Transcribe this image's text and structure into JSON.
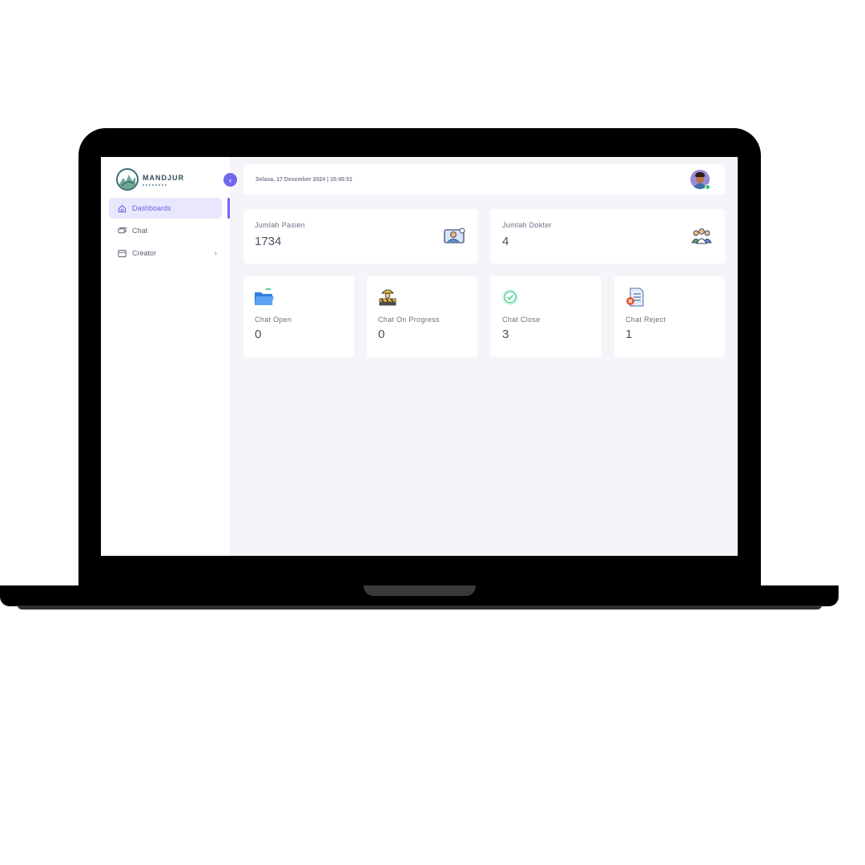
{
  "app": {
    "logo_name": "MANDJUR"
  },
  "sidebar": {
    "collapse_icon": "chevron-left-icon",
    "items": [
      {
        "label": "Dashboards",
        "icon": "home-icon",
        "active": true
      },
      {
        "label": "Chat",
        "icon": "chat-icon",
        "active": false
      },
      {
        "label": "Creator",
        "icon": "window-icon",
        "active": false,
        "has_submenu": true
      }
    ]
  },
  "header": {
    "datetime": "Selasa, 17 Desember 2024 | 10:45:51"
  },
  "stats": [
    {
      "label": "Jumlah Pasien",
      "value": "1734",
      "icon": "patient-icon"
    },
    {
      "label": "Jumlah Dokter",
      "value": "4",
      "icon": "doctors-icon"
    }
  ],
  "chat_stats": [
    {
      "label": "Chat Open",
      "value": "0",
      "icon": "open-folder-icon"
    },
    {
      "label": "Chat On Progress",
      "value": "0",
      "icon": "under-construction-icon"
    },
    {
      "label": "Chat Close",
      "value": "3",
      "icon": "check-circle-icon"
    },
    {
      "label": "Chat Reject",
      "value": "1",
      "icon": "rejected-document-icon"
    }
  ],
  "colors": {
    "accent": "#7267ef",
    "background": "#f4f4f9",
    "text": "#4a5061"
  }
}
